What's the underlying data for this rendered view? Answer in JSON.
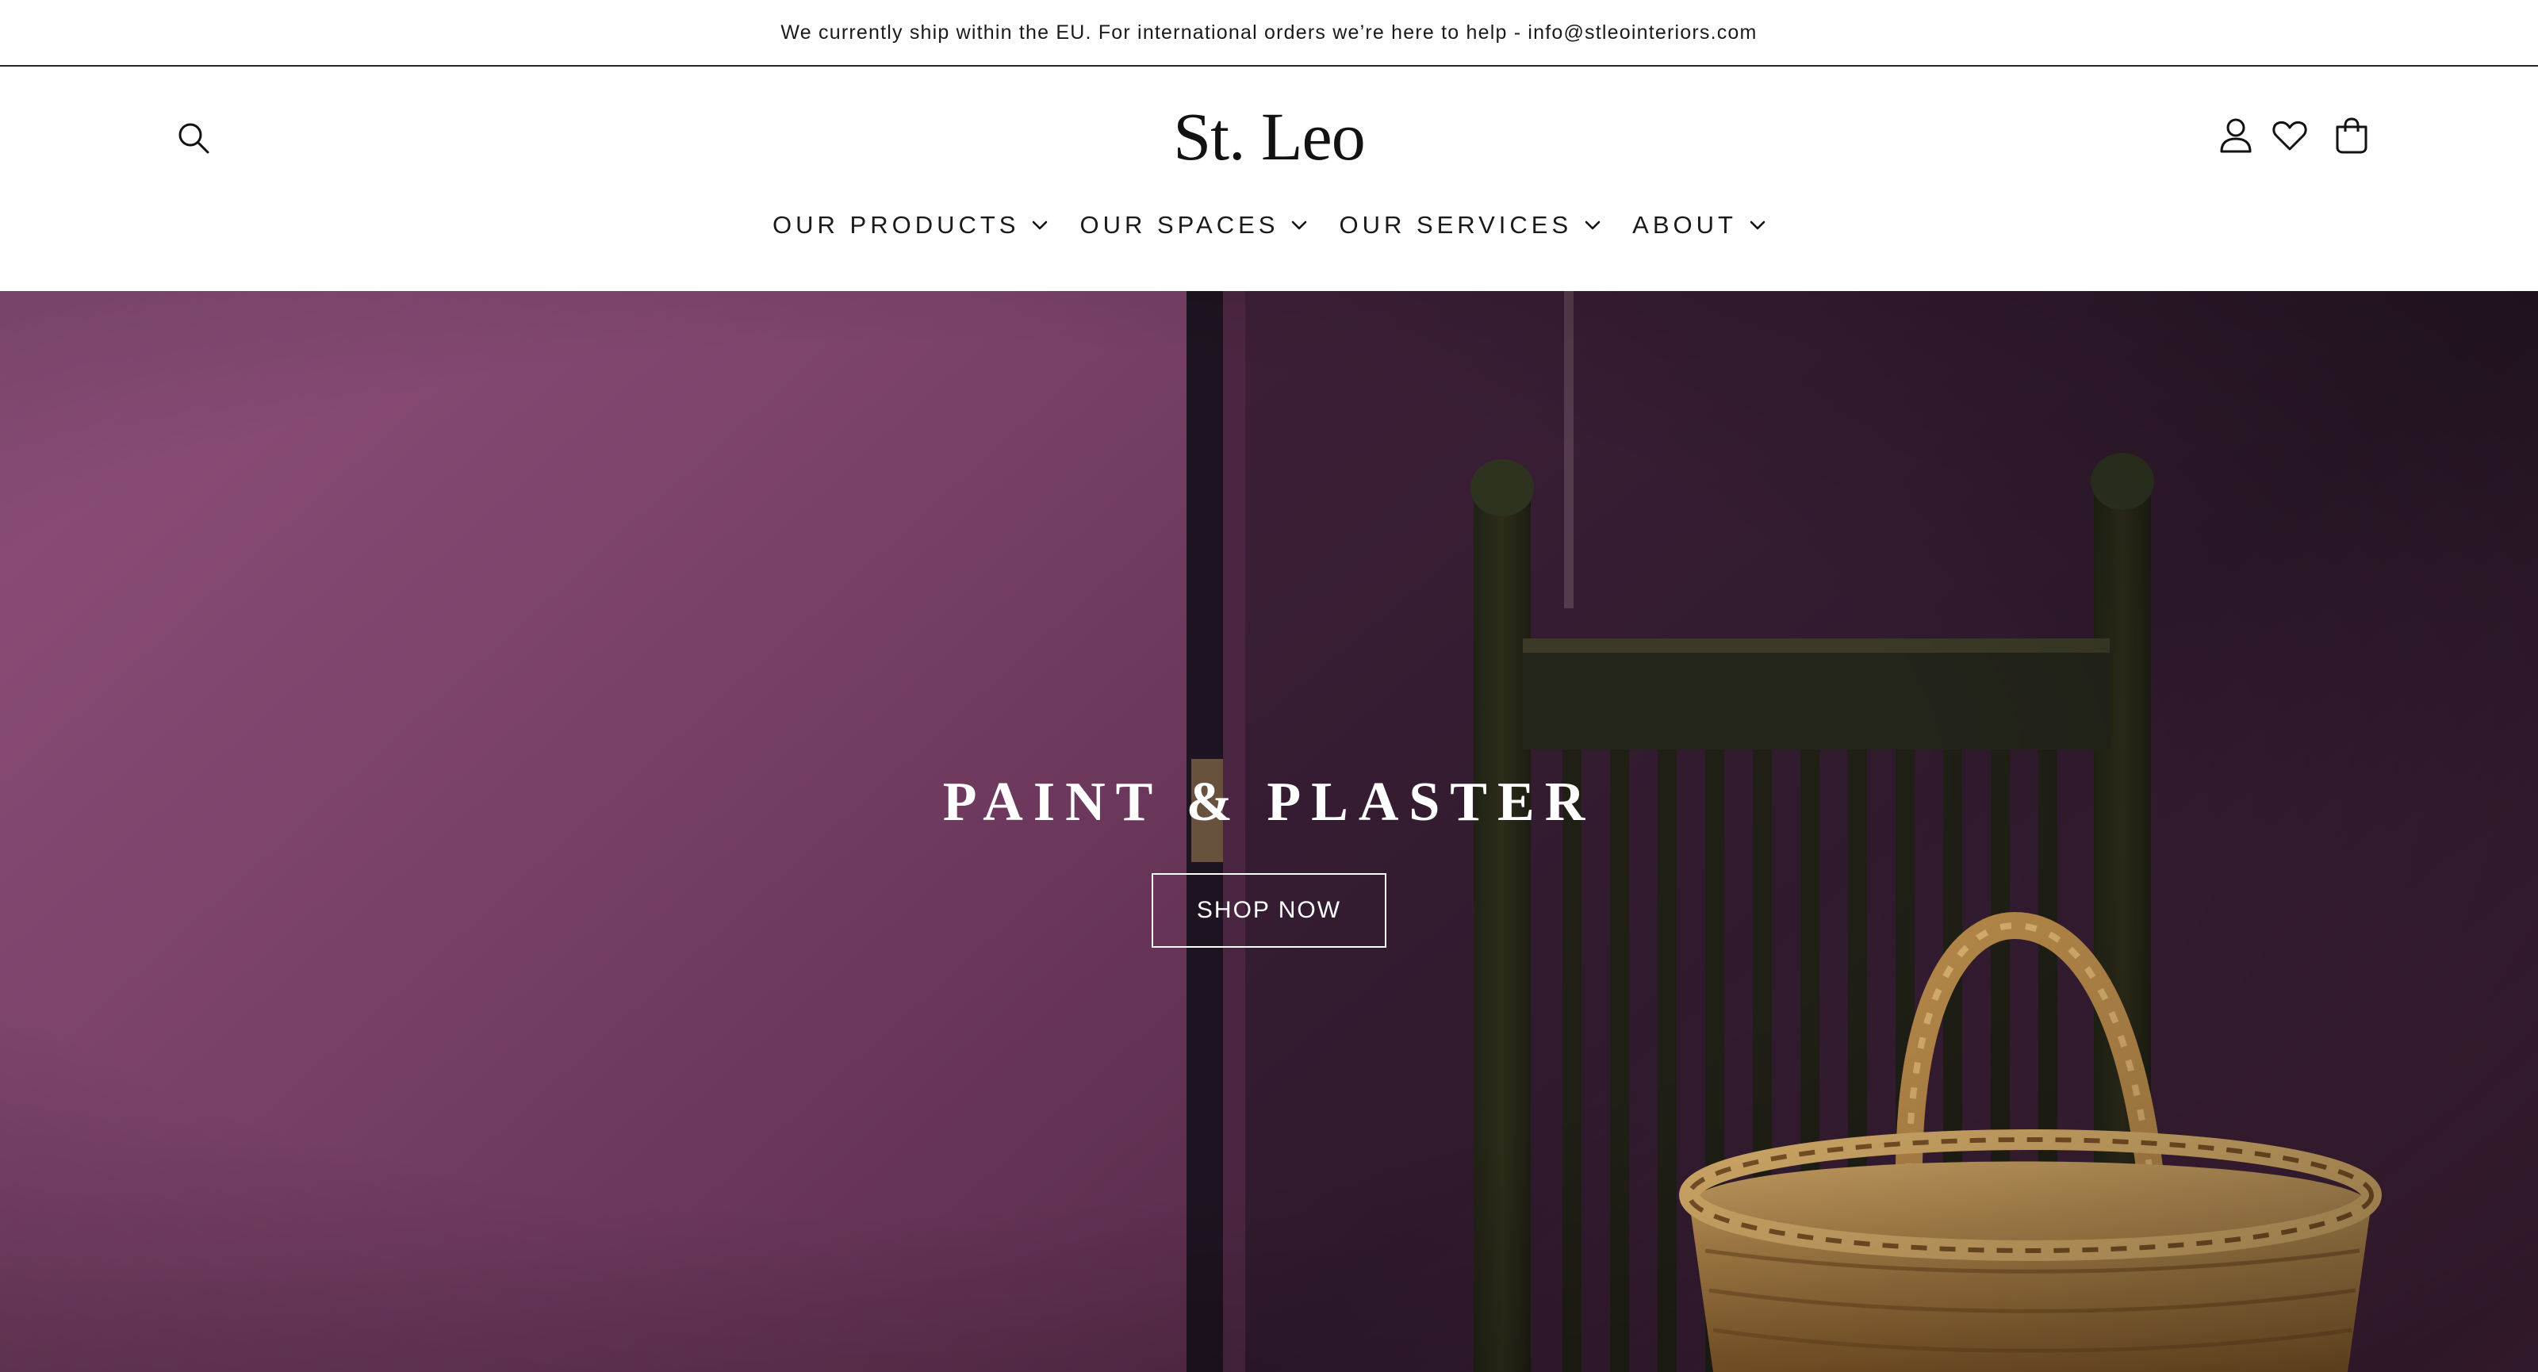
{
  "announcement": {
    "text": "We currently ship within the EU. For international orders we’re here to help - info@stleointeriors.com"
  },
  "header": {
    "logo": "St. Leo",
    "icons": {
      "search": "search-icon",
      "account": "account-icon",
      "wishlist": "heart-icon",
      "cart": "bag-icon"
    },
    "nav": [
      {
        "label": "OUR PRODUCTS"
      },
      {
        "label": "OUR SPACES"
      },
      {
        "label": "OUR SERVICES"
      },
      {
        "label": "ABOUT"
      }
    ]
  },
  "hero": {
    "title": "PAINT & PLASTER",
    "button": "SHOP NOW"
  },
  "colors": {
    "wall": "#7b4269",
    "wall_dark": "#3a1d33",
    "chair": "#2a2718",
    "basket": "#b98d4f"
  }
}
